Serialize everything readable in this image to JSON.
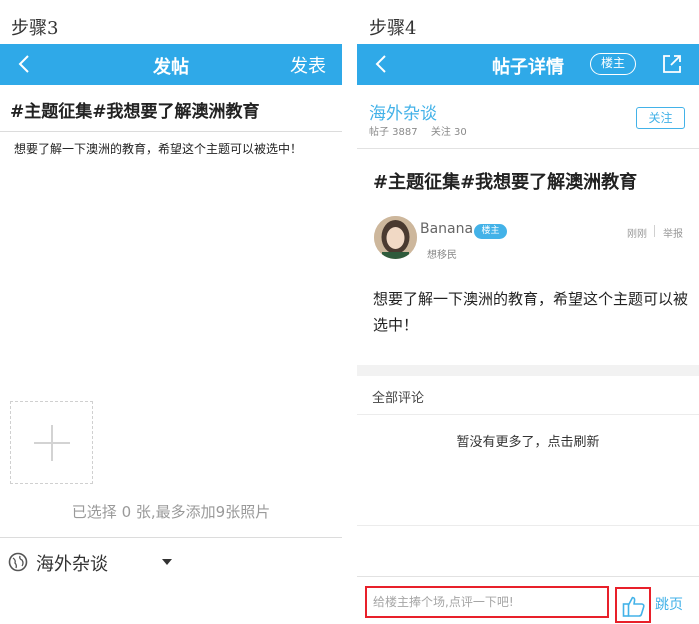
{
  "colors": {
    "accent": "#2fa9e8",
    "link": "#43b2e8",
    "highlight": "#e8202a"
  },
  "left": {
    "step": "步骤3",
    "topbar": {
      "back_icon": "chevron-left-icon",
      "title": "发帖",
      "publish": "发表"
    },
    "title_value": "#主题征集#我想要了解澳洲教育",
    "body_value": "想要了解一下澳洲的教育，希望这个主题可以被选中！",
    "add_photo_icon": "plus-icon",
    "photo_hint": "已选择 0 张,最多添加9张照片",
    "board": {
      "icon": "globe-icon",
      "label": "海外杂谈",
      "dropdown_icon": "caret-down-icon"
    }
  },
  "right": {
    "step": "步骤4",
    "topbar": {
      "back_icon": "chevron-left-icon",
      "title": "帖子详情",
      "owner_filter": "楼主",
      "share_icon": "share-icon"
    },
    "board": {
      "name": "海外杂谈",
      "posts": "帖子 3887",
      "follows": "关注 30",
      "follow_button": "关注"
    },
    "post": {
      "title": "#主题征集#我想要了解澳洲教育",
      "author": "Banana",
      "owner_badge": "楼主",
      "author_tag": "想移民",
      "time": "刚刚",
      "report": "举报",
      "content": "想要了解一下澳洲的教育，希望这个主题可以被选中！"
    },
    "comments": {
      "header": "全部评论",
      "empty": "暂没有更多了，点击刷新"
    },
    "comment_bar": {
      "placeholder": "给楼主捧个场,点评一下吧!",
      "like_icon": "thumbs-up-icon",
      "jump": "跳页"
    }
  }
}
